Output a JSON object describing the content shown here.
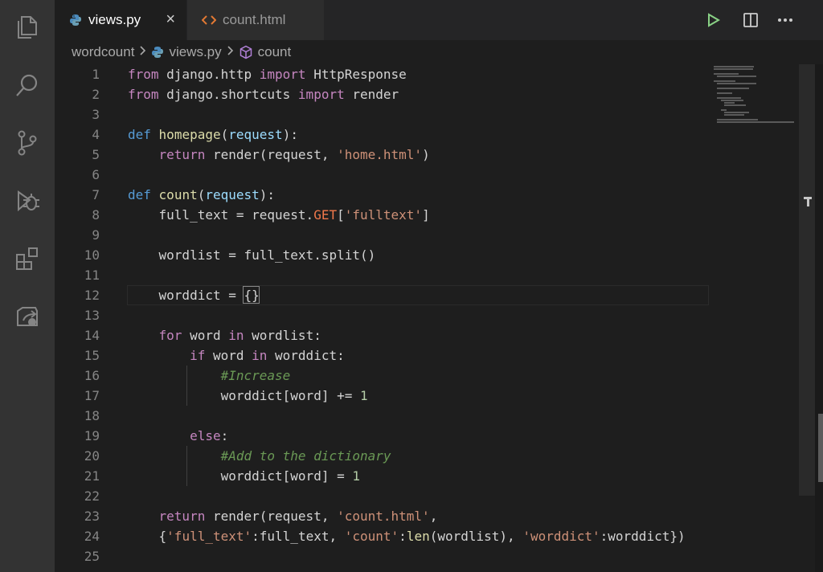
{
  "tabs": [
    {
      "label": "views.py",
      "icon": "python-icon",
      "active": true
    },
    {
      "label": "count.html",
      "icon": "html-icon",
      "active": false
    }
  ],
  "tab_close_glyph": "×",
  "breadcrumb": [
    "wordcount",
    "views.py",
    "count"
  ],
  "activity_icons": [
    "explorer-icon",
    "search-icon",
    "source-control-icon",
    "debug-icon",
    "extensions-icon",
    "remote-icon"
  ],
  "toolbar_icons": [
    "run-icon",
    "split-editor-icon",
    "more-actions-icon"
  ],
  "colors": {
    "keyword": "#c586c0",
    "def": "#569cd6",
    "function": "#dcdcaa",
    "string": "#ce9178",
    "number": "#b5cea8",
    "comment": "#6a9955",
    "variable": "#9cdcfe"
  },
  "code_lines": [
    {
      "n": "1",
      "text": "from django.http import HttpResponse"
    },
    {
      "n": "2",
      "text": "from django.shortcuts import render"
    },
    {
      "n": "3",
      "text": ""
    },
    {
      "n": "4",
      "text": "def homepage(request):"
    },
    {
      "n": "5",
      "text": "    return render(request, 'home.html')"
    },
    {
      "n": "6",
      "text": ""
    },
    {
      "n": "7",
      "text": "def count(request):"
    },
    {
      "n": "8",
      "text": "    full_text = request.GET['fulltext']"
    },
    {
      "n": "9",
      "text": ""
    },
    {
      "n": "10",
      "text": "    wordlist = full_text.split()"
    },
    {
      "n": "11",
      "text": ""
    },
    {
      "n": "12",
      "text": "    worddict = {}"
    },
    {
      "n": "13",
      "text": ""
    },
    {
      "n": "14",
      "text": "    for word in wordlist:"
    },
    {
      "n": "15",
      "text": "        if word in worddict:"
    },
    {
      "n": "16",
      "text": "            #Increase"
    },
    {
      "n": "17",
      "text": "            worddict[word] += 1"
    },
    {
      "n": "18",
      "text": ""
    },
    {
      "n": "19",
      "text": "        else:"
    },
    {
      "n": "20",
      "text": "            #Add to the dictionary"
    },
    {
      "n": "21",
      "text": "            worddict[word] = 1"
    },
    {
      "n": "22",
      "text": ""
    },
    {
      "n": "23",
      "text": "    return render(request, 'count.html',"
    },
    {
      "n": "24",
      "text": "    {'full_text':full_text, 'count':len(wordlist), 'worddict':worddict})"
    },
    {
      "n": "25",
      "text": ""
    }
  ]
}
